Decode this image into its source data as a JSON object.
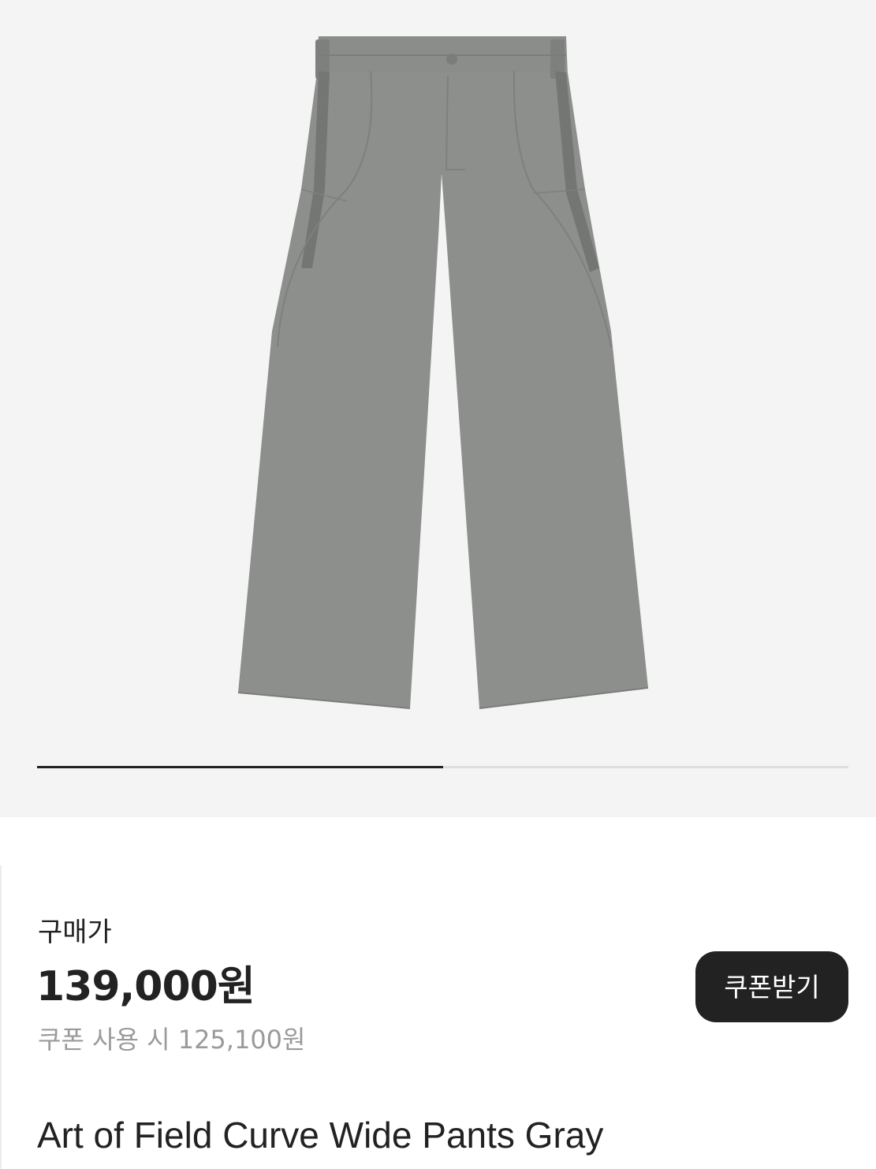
{
  "gallery": {
    "image_alt": "pants-image",
    "background": "#f4f4f4",
    "pager": {
      "total_slides": 2,
      "current_slide": 1
    }
  },
  "purchase": {
    "price_label": "구매가",
    "price": "139,000원",
    "coupon_price_text": "쿠폰 사용 시 125,100원",
    "coupon_button_label": "쿠폰받기"
  },
  "product": {
    "name": "Art of Field Curve Wide Pants Gray"
  },
  "colors": {
    "accent": "#222222",
    "muted_text": "#9a9a9a",
    "product_color": "#8c8f8b"
  }
}
